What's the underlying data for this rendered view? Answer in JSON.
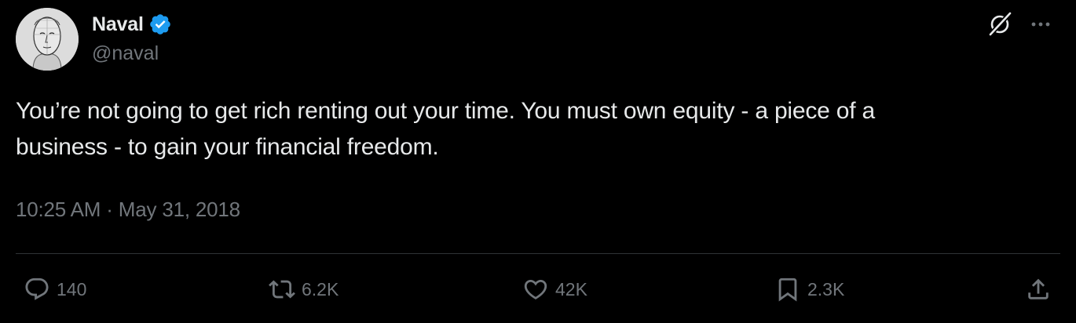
{
  "author": {
    "display_name": "Naval",
    "handle": "@naval",
    "verified": true,
    "verified_color": "#1d9bf0",
    "avatar_icon": "sketch-portrait"
  },
  "header_actions": {
    "grok_icon": "grok-icon",
    "more_icon": "more-icon"
  },
  "tweet": {
    "text_lines": [
      "You’re not going to get rich renting out your time. You must own equity - a piece of a",
      "business - to gain your financial freedom."
    ],
    "time": "10:25 AM",
    "separator": "·",
    "date": "May 31, 2018"
  },
  "engagement": {
    "replies": "140",
    "reposts": "6.2K",
    "likes": "42K",
    "bookmarks": "2.3K"
  },
  "colors": {
    "background": "#000000",
    "primary_text": "#e7e9ea",
    "secondary_text": "#71767b",
    "divider": "#2f3336"
  }
}
